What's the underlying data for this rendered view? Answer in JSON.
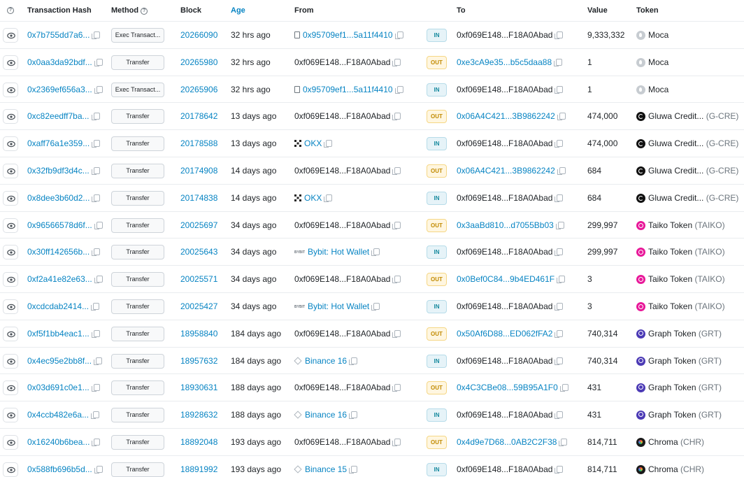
{
  "header": {
    "col_hash": "Transaction Hash",
    "col_method": "Method",
    "col_block": "Block",
    "col_age": "Age",
    "col_from": "From",
    "col_to": "To",
    "col_value": "Value",
    "col_token": "Token"
  },
  "rows": [
    {
      "hash": "0x7b755dd7a6...",
      "method": "Exec Transact...",
      "block": "20266090",
      "age": "32 hrs ago",
      "from": "0x95709ef1...5a11f4410",
      "from_type": "contract",
      "from_link": true,
      "dir": "IN",
      "to": "0xf069E148...F18A0Abad",
      "to_link": false,
      "value": "9,333,332",
      "token": "Moca",
      "token_sym": "",
      "token_icon": "moca"
    },
    {
      "hash": "0x0aa3da92bdf...",
      "method": "Transfer",
      "block": "20265980",
      "age": "32 hrs ago",
      "from": "0xf069E148...F18A0Abad",
      "from_type": "plain",
      "from_link": false,
      "dir": "OUT",
      "to": "0xe3cA9e35...b5c5daa88",
      "to_link": true,
      "value": "1",
      "token": "Moca",
      "token_sym": "",
      "token_icon": "moca"
    },
    {
      "hash": "0x2369ef656a3...",
      "method": "Exec Transact...",
      "block": "20265906",
      "age": "32 hrs ago",
      "from": "0x95709ef1...5a11f4410",
      "from_type": "contract",
      "from_link": true,
      "dir": "IN",
      "to": "0xf069E148...F18A0Abad",
      "to_link": false,
      "value": "1",
      "token": "Moca",
      "token_sym": "",
      "token_icon": "moca"
    },
    {
      "hash": "0xc82eedff7ba...",
      "method": "Transfer",
      "block": "20178642",
      "age": "13 days ago",
      "from": "0xf069E148...F18A0Abad",
      "from_type": "plain",
      "from_link": false,
      "dir": "OUT",
      "to": "0x06A4C421...3B9862242",
      "to_link": true,
      "value": "474,000",
      "token": "Gluwa Credit...",
      "token_sym": "(G-CRE)",
      "token_icon": "gluwa"
    },
    {
      "hash": "0xaff76a1e359...",
      "method": "Transfer",
      "block": "20178588",
      "age": "13 days ago",
      "from": "OKX",
      "from_type": "okx",
      "from_link": true,
      "dir": "IN",
      "to": "0xf069E148...F18A0Abad",
      "to_link": false,
      "value": "474,000",
      "token": "Gluwa Credit...",
      "token_sym": "(G-CRE)",
      "token_icon": "gluwa"
    },
    {
      "hash": "0x32fb9df3d4c...",
      "method": "Transfer",
      "block": "20174908",
      "age": "14 days ago",
      "from": "0xf069E148...F18A0Abad",
      "from_type": "plain",
      "from_link": false,
      "dir": "OUT",
      "to": "0x06A4C421...3B9862242",
      "to_link": true,
      "value": "684",
      "token": "Gluwa Credit...",
      "token_sym": "(G-CRE)",
      "token_icon": "gluwa"
    },
    {
      "hash": "0x8dee3b60d2...",
      "method": "Transfer",
      "block": "20174838",
      "age": "14 days ago",
      "from": "OKX",
      "from_type": "okx",
      "from_link": true,
      "dir": "IN",
      "to": "0xf069E148...F18A0Abad",
      "to_link": false,
      "value": "684",
      "token": "Gluwa Credit...",
      "token_sym": "(G-CRE)",
      "token_icon": "gluwa"
    },
    {
      "hash": "0x96566578d6f...",
      "method": "Transfer",
      "block": "20025697",
      "age": "34 days ago",
      "from": "0xf069E148...F18A0Abad",
      "from_type": "plain",
      "from_link": false,
      "dir": "OUT",
      "to": "0x3aaBd810...d7055Bb03",
      "to_link": true,
      "value": "299,997",
      "token": "Taiko Token",
      "token_sym": "(TAIKO)",
      "token_icon": "taiko"
    },
    {
      "hash": "0x30ff142656b...",
      "method": "Transfer",
      "block": "20025643",
      "age": "34 days ago",
      "from": "Bybit: Hot Wallet",
      "from_type": "bybit",
      "from_link": true,
      "dir": "IN",
      "to": "0xf069E148...F18A0Abad",
      "to_link": false,
      "value": "299,997",
      "token": "Taiko Token",
      "token_sym": "(TAIKO)",
      "token_icon": "taiko"
    },
    {
      "hash": "0xf2a41e82e63...",
      "method": "Transfer",
      "block": "20025571",
      "age": "34 days ago",
      "from": "0xf069E148...F18A0Abad",
      "from_type": "plain",
      "from_link": false,
      "dir": "OUT",
      "to": "0x0Bef0C84...9b4ED461F",
      "to_link": true,
      "value": "3",
      "token": "Taiko Token",
      "token_sym": "(TAIKO)",
      "token_icon": "taiko"
    },
    {
      "hash": "0xcdcdab2414...",
      "method": "Transfer",
      "block": "20025427",
      "age": "34 days ago",
      "from": "Bybit: Hot Wallet",
      "from_type": "bybit",
      "from_link": true,
      "dir": "IN",
      "to": "0xf069E148...F18A0Abad",
      "to_link": false,
      "value": "3",
      "token": "Taiko Token",
      "token_sym": "(TAIKO)",
      "token_icon": "taiko"
    },
    {
      "hash": "0xf5f1bb4eac1...",
      "method": "Transfer",
      "block": "18958840",
      "age": "184 days ago",
      "from": "0xf069E148...F18A0Abad",
      "from_type": "plain",
      "from_link": false,
      "dir": "OUT",
      "to": "0x50Af6D88...ED062fFA2",
      "to_link": true,
      "value": "740,314",
      "token": "Graph Token",
      "token_sym": "(GRT)",
      "token_icon": "grt"
    },
    {
      "hash": "0x4ec95e2bb8f...",
      "method": "Transfer",
      "block": "18957632",
      "age": "184 days ago",
      "from": "Binance 16",
      "from_type": "binance",
      "from_link": true,
      "dir": "IN",
      "to": "0xf069E148...F18A0Abad",
      "to_link": false,
      "value": "740,314",
      "token": "Graph Token",
      "token_sym": "(GRT)",
      "token_icon": "grt"
    },
    {
      "hash": "0x03d691c0e1...",
      "method": "Transfer",
      "block": "18930631",
      "age": "188 days ago",
      "from": "0xf069E148...F18A0Abad",
      "from_type": "plain",
      "from_link": false,
      "dir": "OUT",
      "to": "0x4C3CBe08...59B95A1F0",
      "to_link": true,
      "value": "431",
      "token": "Graph Token",
      "token_sym": "(GRT)",
      "token_icon": "grt"
    },
    {
      "hash": "0x4ccb482e6a...",
      "method": "Transfer",
      "block": "18928632",
      "age": "188 days ago",
      "from": "Binance 16",
      "from_type": "binance",
      "from_link": true,
      "dir": "IN",
      "to": "0xf069E148...F18A0Abad",
      "to_link": false,
      "value": "431",
      "token": "Graph Token",
      "token_sym": "(GRT)",
      "token_icon": "grt"
    },
    {
      "hash": "0x16240b6bea...",
      "method": "Transfer",
      "block": "18892048",
      "age": "193 days ago",
      "from": "0xf069E148...F18A0Abad",
      "from_type": "plain",
      "from_link": false,
      "dir": "OUT",
      "to": "0x4d9e7D68...0AB2C2F38",
      "to_link": true,
      "value": "814,711",
      "token": "Chroma",
      "token_sym": "(CHR)",
      "token_icon": "chr"
    },
    {
      "hash": "0x588fb696b5d...",
      "method": "Transfer",
      "block": "18891992",
      "age": "193 days ago",
      "from": "Binance 15",
      "from_type": "binance",
      "from_link": true,
      "dir": "IN",
      "to": "0xf069E148...F18A0Abad",
      "to_link": false,
      "value": "814,711",
      "token": "Chroma",
      "token_sym": "(CHR)",
      "token_icon": "chr"
    }
  ]
}
